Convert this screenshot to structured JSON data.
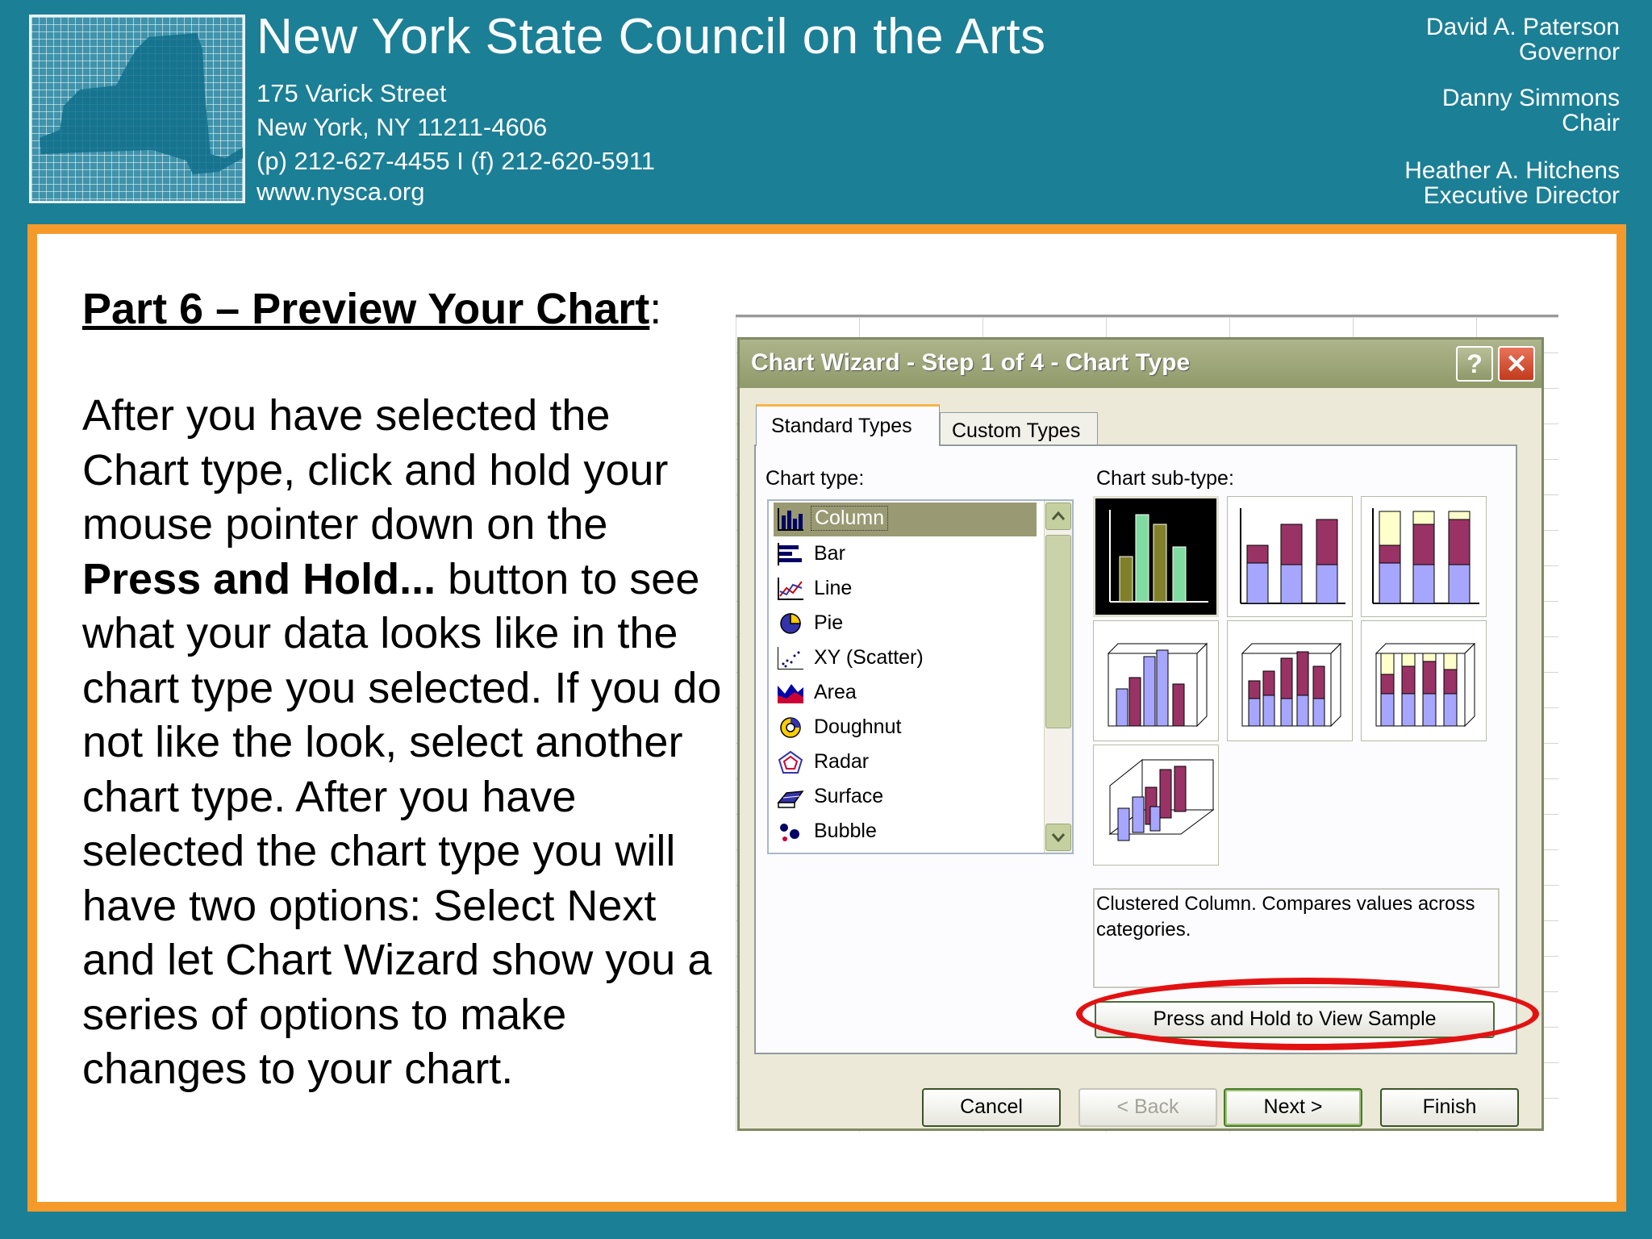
{
  "header": {
    "org_name": "New York State Council on the Arts",
    "address_line1": "175 Varick Street",
    "address_line2": "New York, NY 11211-4606",
    "phone_line": "(p) 212-627-4455 I (f) 212-620-5911",
    "website": "www.nysca.org",
    "officers": [
      {
        "name": "David A. Paterson",
        "title": "Governor"
      },
      {
        "name": "Danny Simmons",
        "title": "Chair"
      },
      {
        "name": "Heather A. Hitchens",
        "title": "Executive Director"
      }
    ]
  },
  "slide": {
    "title": "Part 6 – Preview Your Chart",
    "title_colon": ":",
    "body_1": "After you have selected the Chart type, click and hold your mouse pointer down on the ",
    "body_bold": "Press and Hold...",
    "body_2": " button to see what your data looks like in the chart type you selected. If you do not like the look, select another chart type. After you have selected the chart type you will have two options: Select Next and let Chart Wizard show you a series of options to make changes to your chart."
  },
  "dialog": {
    "title": "Chart Wizard - Step 1 of 4 - Chart Type",
    "help_label": "?",
    "close_label": "✕",
    "tabs": {
      "standard": "Standard Types",
      "custom": "Custom Types"
    },
    "chart_type_label": "Chart type:",
    "chart_subtype_label": "Chart sub-type:",
    "chart_types": [
      "Column",
      "Bar",
      "Line",
      "Pie",
      "XY (Scatter)",
      "Area",
      "Doughnut",
      "Radar",
      "Surface",
      "Bubble"
    ],
    "selected_chart_type": "Column",
    "description": "Clustered Column. Compares values across categories.",
    "press_hold_label": "Press and Hold to View Sample",
    "buttons": {
      "cancel": "Cancel",
      "back": "< Back",
      "next": "Next >",
      "finish": "Finish"
    }
  },
  "colors": {
    "header_bg": "#1b7f96",
    "slide_border": "#f59a2a",
    "highlight_ellipse": "#e21212",
    "series_purple": "#a6a6ff",
    "series_maroon": "#993366",
    "series_cream": "#ffffcc",
    "series_green": "#7fdba0",
    "series_olive": "#80802a"
  }
}
